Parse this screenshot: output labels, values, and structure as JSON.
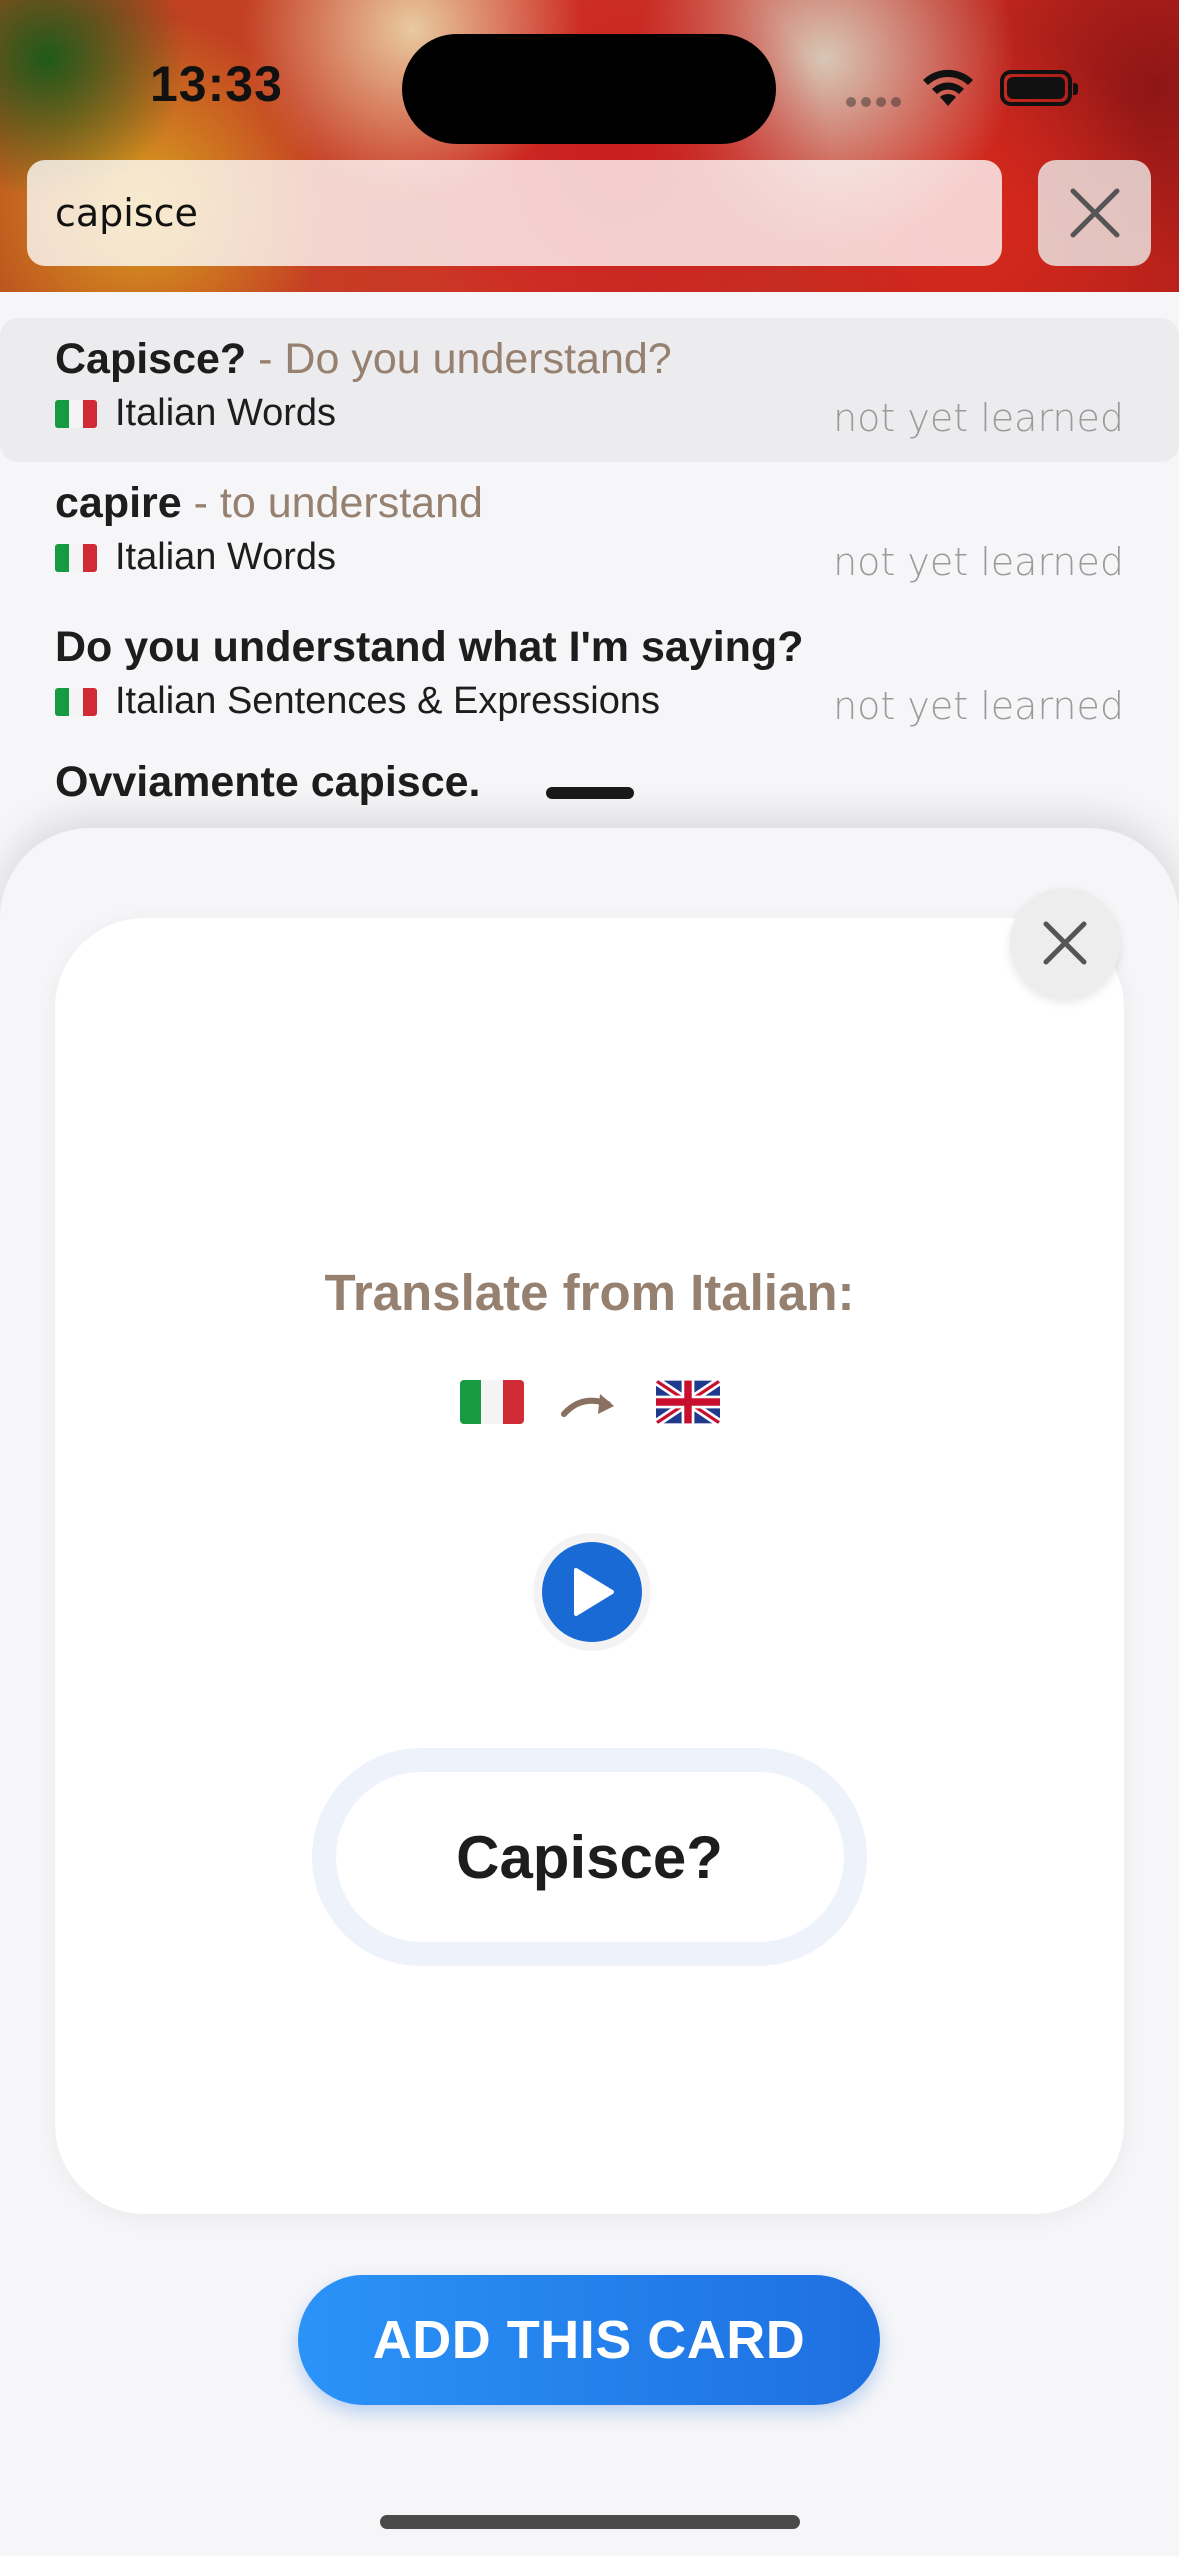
{
  "status_bar": {
    "time": "13:33"
  },
  "search": {
    "value": "capisce"
  },
  "results": [
    {
      "word": "Capisce?",
      "separator": " - ",
      "meaning": "Do you understand?",
      "deck": "Italian Words",
      "status": "not yet learned",
      "selected": true
    },
    {
      "word": "capire",
      "separator": " - ",
      "meaning": "to understand",
      "deck": "Italian Words",
      "status": "not yet learned",
      "selected": false
    },
    {
      "word": "Do you understand what I'm saying?",
      "separator": "",
      "meaning": "",
      "deck": "Italian Sentences & Expressions",
      "status": "not yet learned",
      "selected": false
    }
  ],
  "partial_result": {
    "word": "Ovviamente capisce."
  },
  "card": {
    "prompt": "Translate from Italian:",
    "from_language": "Italian",
    "to_language": "English",
    "word": "Capisce?"
  },
  "actions": {
    "add_card_label": "ADD THIS CARD"
  },
  "icons": {
    "close": "close-icon",
    "play": "play-icon",
    "arrow": "curved-arrow-icon",
    "wifi": "wifi-icon",
    "battery": "battery-icon"
  },
  "colors": {
    "accent_blue": "#1e6fe0",
    "meaning_brown": "#96806f",
    "status_gray": "#9a9a9a",
    "italy_green": "#169b43",
    "italy_red": "#d02a35"
  }
}
